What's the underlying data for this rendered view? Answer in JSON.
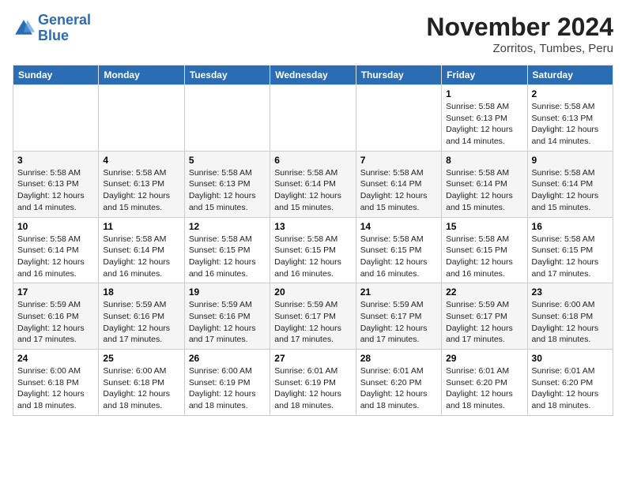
{
  "logo": {
    "line1": "General",
    "line2": "Blue"
  },
  "title": "November 2024",
  "location": "Zorritos, Tumbes, Peru",
  "weekdays": [
    "Sunday",
    "Monday",
    "Tuesday",
    "Wednesday",
    "Thursday",
    "Friday",
    "Saturday"
  ],
  "weeks": [
    [
      {
        "day": "",
        "info": ""
      },
      {
        "day": "",
        "info": ""
      },
      {
        "day": "",
        "info": ""
      },
      {
        "day": "",
        "info": ""
      },
      {
        "day": "",
        "info": ""
      },
      {
        "day": "1",
        "info": "Sunrise: 5:58 AM\nSunset: 6:13 PM\nDaylight: 12 hours and 14 minutes."
      },
      {
        "day": "2",
        "info": "Sunrise: 5:58 AM\nSunset: 6:13 PM\nDaylight: 12 hours and 14 minutes."
      }
    ],
    [
      {
        "day": "3",
        "info": "Sunrise: 5:58 AM\nSunset: 6:13 PM\nDaylight: 12 hours and 14 minutes."
      },
      {
        "day": "4",
        "info": "Sunrise: 5:58 AM\nSunset: 6:13 PM\nDaylight: 12 hours and 15 minutes."
      },
      {
        "day": "5",
        "info": "Sunrise: 5:58 AM\nSunset: 6:13 PM\nDaylight: 12 hours and 15 minutes."
      },
      {
        "day": "6",
        "info": "Sunrise: 5:58 AM\nSunset: 6:14 PM\nDaylight: 12 hours and 15 minutes."
      },
      {
        "day": "7",
        "info": "Sunrise: 5:58 AM\nSunset: 6:14 PM\nDaylight: 12 hours and 15 minutes."
      },
      {
        "day": "8",
        "info": "Sunrise: 5:58 AM\nSunset: 6:14 PM\nDaylight: 12 hours and 15 minutes."
      },
      {
        "day": "9",
        "info": "Sunrise: 5:58 AM\nSunset: 6:14 PM\nDaylight: 12 hours and 15 minutes."
      }
    ],
    [
      {
        "day": "10",
        "info": "Sunrise: 5:58 AM\nSunset: 6:14 PM\nDaylight: 12 hours and 16 minutes."
      },
      {
        "day": "11",
        "info": "Sunrise: 5:58 AM\nSunset: 6:14 PM\nDaylight: 12 hours and 16 minutes."
      },
      {
        "day": "12",
        "info": "Sunrise: 5:58 AM\nSunset: 6:15 PM\nDaylight: 12 hours and 16 minutes."
      },
      {
        "day": "13",
        "info": "Sunrise: 5:58 AM\nSunset: 6:15 PM\nDaylight: 12 hours and 16 minutes."
      },
      {
        "day": "14",
        "info": "Sunrise: 5:58 AM\nSunset: 6:15 PM\nDaylight: 12 hours and 16 minutes."
      },
      {
        "day": "15",
        "info": "Sunrise: 5:58 AM\nSunset: 6:15 PM\nDaylight: 12 hours and 16 minutes."
      },
      {
        "day": "16",
        "info": "Sunrise: 5:58 AM\nSunset: 6:15 PM\nDaylight: 12 hours and 17 minutes."
      }
    ],
    [
      {
        "day": "17",
        "info": "Sunrise: 5:59 AM\nSunset: 6:16 PM\nDaylight: 12 hours and 17 minutes."
      },
      {
        "day": "18",
        "info": "Sunrise: 5:59 AM\nSunset: 6:16 PM\nDaylight: 12 hours and 17 minutes."
      },
      {
        "day": "19",
        "info": "Sunrise: 5:59 AM\nSunset: 6:16 PM\nDaylight: 12 hours and 17 minutes."
      },
      {
        "day": "20",
        "info": "Sunrise: 5:59 AM\nSunset: 6:17 PM\nDaylight: 12 hours and 17 minutes."
      },
      {
        "day": "21",
        "info": "Sunrise: 5:59 AM\nSunset: 6:17 PM\nDaylight: 12 hours and 17 minutes."
      },
      {
        "day": "22",
        "info": "Sunrise: 5:59 AM\nSunset: 6:17 PM\nDaylight: 12 hours and 17 minutes."
      },
      {
        "day": "23",
        "info": "Sunrise: 6:00 AM\nSunset: 6:18 PM\nDaylight: 12 hours and 18 minutes."
      }
    ],
    [
      {
        "day": "24",
        "info": "Sunrise: 6:00 AM\nSunset: 6:18 PM\nDaylight: 12 hours and 18 minutes."
      },
      {
        "day": "25",
        "info": "Sunrise: 6:00 AM\nSunset: 6:18 PM\nDaylight: 12 hours and 18 minutes."
      },
      {
        "day": "26",
        "info": "Sunrise: 6:00 AM\nSunset: 6:19 PM\nDaylight: 12 hours and 18 minutes."
      },
      {
        "day": "27",
        "info": "Sunrise: 6:01 AM\nSunset: 6:19 PM\nDaylight: 12 hours and 18 minutes."
      },
      {
        "day": "28",
        "info": "Sunrise: 6:01 AM\nSunset: 6:20 PM\nDaylight: 12 hours and 18 minutes."
      },
      {
        "day": "29",
        "info": "Sunrise: 6:01 AM\nSunset: 6:20 PM\nDaylight: 12 hours and 18 minutes."
      },
      {
        "day": "30",
        "info": "Sunrise: 6:01 AM\nSunset: 6:20 PM\nDaylight: 12 hours and 18 minutes."
      }
    ]
  ]
}
